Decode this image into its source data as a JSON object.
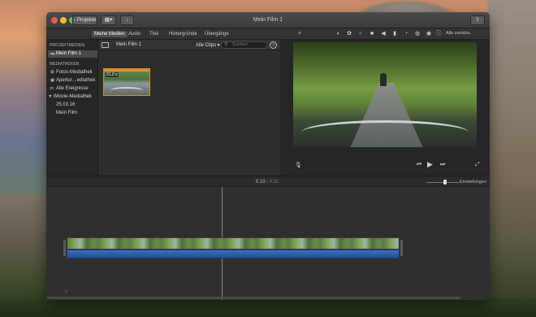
{
  "window": {
    "title": "Mein Film 1"
  },
  "titlebar": {
    "back_label": "Projekte",
    "view_icon": "grid-view-icon",
    "import_icon": "import-arrow-icon",
    "share_icon": "share-icon"
  },
  "media_tabs": [
    "Meine Medien",
    "Audio",
    "Titel",
    "Hintergründe",
    "Übergänge"
  ],
  "viewer_tools": {
    "reset_label": "Alle zurücks."
  },
  "sidebar": {
    "section_project": "PROJEKTMEDIEN",
    "project_item": "Mein Film 1",
    "section_libraries": "MEDIATHEKEN",
    "items": [
      {
        "label": "Fotos-Mediathek",
        "icon": "photos-icon"
      },
      {
        "label": "Apertur…ediathek",
        "icon": "aperture-icon"
      },
      {
        "label": "Alle Ereignisse",
        "icon": "events-icon"
      }
    ],
    "library": "iMovie-Mediathek",
    "event_date": "25.03.16",
    "event_film": "Mein Film"
  },
  "browser": {
    "title": "Mein Film 1",
    "filter": "Alle Clips",
    "search_placeholder": "Suchen",
    "clip_duration": "31,0 s"
  },
  "timeline": {
    "current_time": "0:10",
    "separator": "/",
    "total_time": "0:31",
    "settings_label": "Einstellungen"
  },
  "colors": {
    "accent": "#4a90e2",
    "clip_selected": "#d98c2e",
    "audio": "#2f5ea8"
  }
}
